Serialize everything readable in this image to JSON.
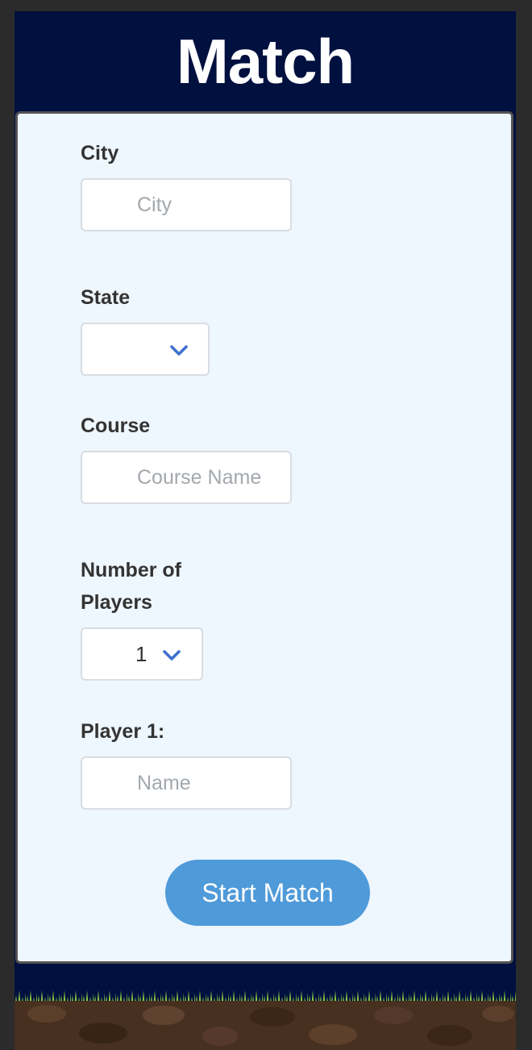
{
  "header": {
    "title": "Match"
  },
  "form": {
    "city": {
      "label": "City",
      "placeholder": "City",
      "value": ""
    },
    "state": {
      "label": "State",
      "selected": ""
    },
    "course": {
      "label": "Course",
      "placeholder": "Course Name",
      "value": ""
    },
    "players": {
      "label_line1": "Number of",
      "label_line2": "Players",
      "selected": "1"
    },
    "player1": {
      "label": "Player 1:",
      "placeholder": "Name",
      "value": ""
    },
    "start_button": "Start Match"
  },
  "colors": {
    "header_bg": "#00103f",
    "card_bg": "#eef6fe",
    "accent": "#4f9ad9",
    "chevron": "#3f70cf",
    "label_text": "#333333",
    "placeholder_text": "#a3a8ad"
  },
  "icons": {
    "dropdown": "chevron-down-icon"
  }
}
